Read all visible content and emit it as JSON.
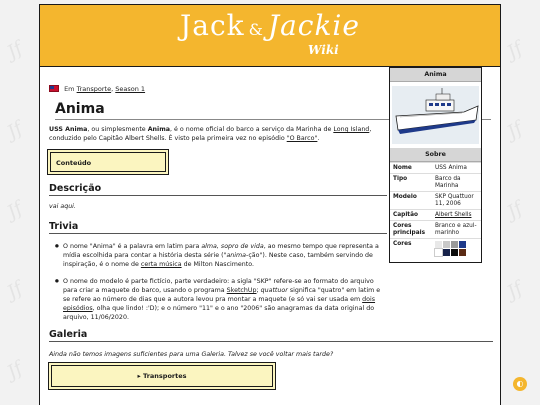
{
  "header": {
    "logo_main": "Jack",
    "logo_amp": "&",
    "logo_second": "Jackie",
    "logo_sub": "Wiki"
  },
  "breadcrumb": {
    "prefix": "Em",
    "link1": "Transporte",
    "sep": ",",
    "link2": "Season 1"
  },
  "page_title": "Anima",
  "intro": {
    "b1": "USS Anima",
    "t1": ", ou simplesmente ",
    "b2": "Anima",
    "t2": ", é o nome oficial do barco a serviço da Marinha de ",
    "link1": "Long Island",
    "t3": ", conduzido pelo Capitão Albert Shells. É visto pela primeira vez no episódio ",
    "link2": "\"O Barco\"",
    "t4": "."
  },
  "toc_label": "Conteúdo",
  "sections": {
    "descricao": "Descrição",
    "descricao_text": "vai aqui.",
    "trivia": "Trivia",
    "galeria": "Galeria",
    "galeria_text": "Ainda não temos imagens suficientes para uma Galeria. Talvez se você voltar mais tarde?"
  },
  "trivia_items": {
    "i1_a": "O nome \"Anima\" é a palavra em latim para ",
    "i1_em": "alma, sopro de vida",
    "i1_b": ", ao mesmo tempo que representa a mídia escolhida para contar a história desta série (\"",
    "i1_em2": "anima",
    "i1_c": "-ção\"). Neste caso, também servindo de inspiração, é o nome de ",
    "i1_link": "certa música",
    "i1_d": " de Milton Nascimento.",
    "i2_a": "O nome do modelo é parte fictício, parte verdadeiro: a sigla \"SKP\" refere-se ao formato do arquivo para criar a maquete do barco, usando o programa ",
    "i2_link1": "SketchUp",
    "i2_b": "; ",
    "i2_em": "quattuor",
    "i2_c": " significa \"quatro\" em latim e se refere ao número de dias que a autora levou pra montar a maquete (e só vai ser usada em ",
    "i2_link2": "dois",
    "i2_sp": " ",
    "i2_link3": "episódios",
    "i2_d": ", olha que lindo! :'D); e o número \"11\" e o ano \"2006\" são anagramas da data original do arquivo, 11/06/2020."
  },
  "nav_box_label": "▸ Transportes",
  "infobox": {
    "title": "Anima",
    "section": "Sobre",
    "rows": [
      {
        "k": "Nome",
        "v": "USS Anima"
      },
      {
        "k": "Tipo",
        "v": "Barco da Marinha"
      },
      {
        "k": "Modelo",
        "v": "SKP Quattuor 11, 2006"
      },
      {
        "k": "Capitão",
        "v": "Albert Shells"
      },
      {
        "k": "Cores principais",
        "v": "Branco e azul-marinho"
      },
      {
        "k": "Cores",
        "v": ""
      }
    ],
    "swatches": [
      "#e8e8e8",
      "#c9c9c9",
      "#9a9a9a",
      "#1f3a8a",
      "#ffffff",
      "#16224a",
      "#0b0b0b",
      "#5a2a14"
    ]
  },
  "colors": {
    "accent": "#f4b62e",
    "panel": "#fbf5c0"
  },
  "icons": {
    "flag": "us-flag-icon",
    "theme": "theme-toggle-icon"
  }
}
